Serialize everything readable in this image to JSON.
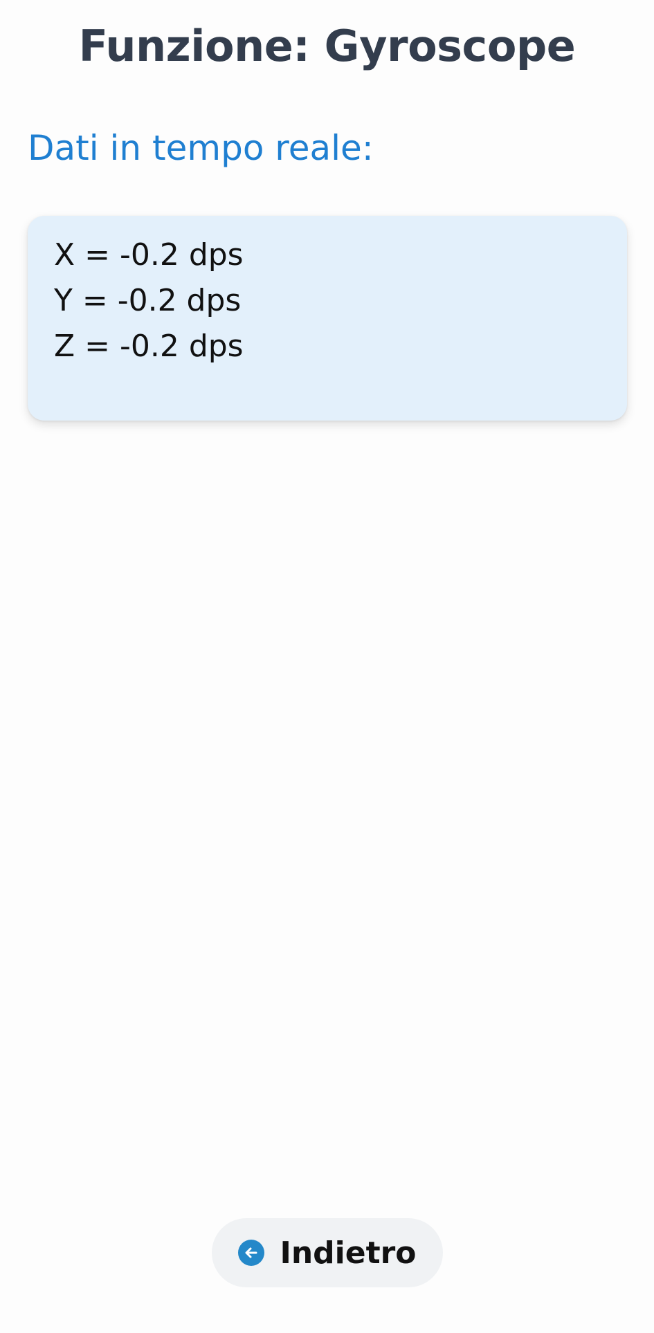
{
  "header": {
    "title": "Funzione: Gyroscope"
  },
  "main": {
    "section_label": "Dati in tempo reale:",
    "readings": [
      {
        "text": "X = -0.2 dps"
      },
      {
        "text": "Y = -0.2 dps"
      },
      {
        "text": "Z = -0.2 dps"
      }
    ]
  },
  "footer": {
    "back_label": "Indietro",
    "back_icon": "arrow-left-circle-icon"
  },
  "colors": {
    "title": "#333d4d",
    "accent": "#1f7fd1",
    "card_background": "#e3f0fb",
    "button_background": "#f0f2f4",
    "icon": "#2488c9"
  }
}
